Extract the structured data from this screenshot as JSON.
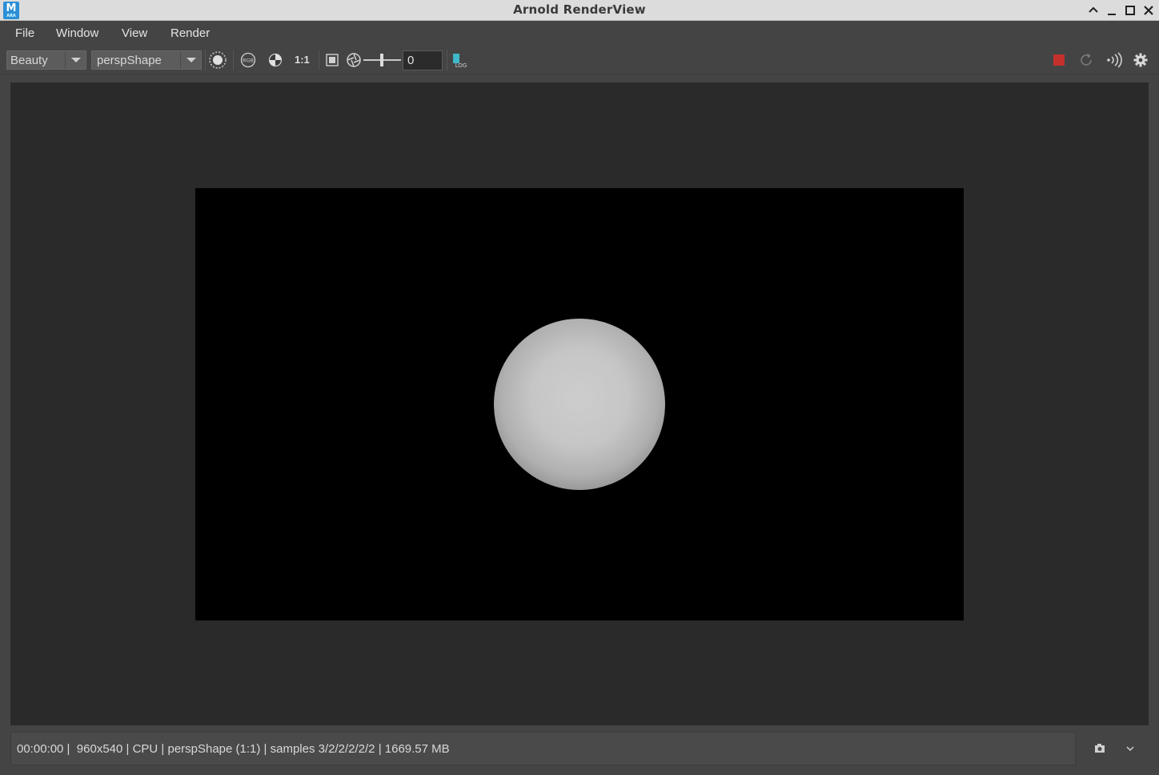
{
  "window": {
    "title": "Arnold RenderView",
    "app_icon_letter": "M",
    "app_icon_sub": "ARA"
  },
  "menu": {
    "items": [
      "File",
      "Window",
      "View",
      "Render"
    ]
  },
  "toolbar": {
    "aov_selected": "Beauty",
    "camera_selected": "perspShape",
    "ratio_label": "1:1",
    "exposure_value": "0",
    "icons": [
      "display-settings-icon",
      "rgb-channels-icon",
      "background-checker-icon",
      "one-to-one-zoom",
      "frame-fit-icon",
      "exposure-icon",
      "log-icon",
      "stop-render-icon",
      "refresh-render-icon",
      "interactive-render-icon",
      "settings-gear-icon"
    ]
  },
  "colors": {
    "stop_button": "#c4302b",
    "log_icon": "#3fb8c8",
    "app_icon": "#2b8fd6"
  },
  "render": {
    "resolution": "960x540"
  },
  "status": {
    "text": "00:00:00 |  960x540 | CPU | perspShape (1:1) | samples 3/2/2/2/2/2 | 1669.57 MB"
  }
}
